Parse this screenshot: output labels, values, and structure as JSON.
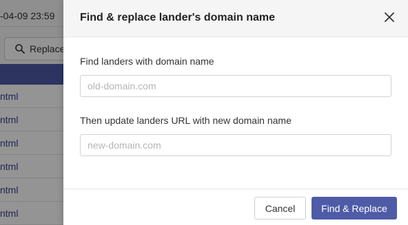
{
  "background": {
    "date_text": "-04-09 23:59",
    "replace_button_label": "Replace",
    "row_suffix": "ntml",
    "rows": [
      "ntml",
      "ntml",
      "ntml",
      "ntml",
      "ntml",
      "ntml"
    ],
    "accent_color": "#4e5ba6"
  },
  "dialog": {
    "title": "Find & replace lander's domain name",
    "close_icon": "close-icon",
    "find_label": "Find landers with domain name",
    "find_placeholder": "old-domain.com",
    "find_value": "",
    "replace_label": "Then update landers URL with new domain name",
    "replace_placeholder": "new-domain.com",
    "replace_value": "",
    "cancel_label": "Cancel",
    "submit_label": "Find & Replace",
    "primary_color": "#4e5ba6"
  }
}
